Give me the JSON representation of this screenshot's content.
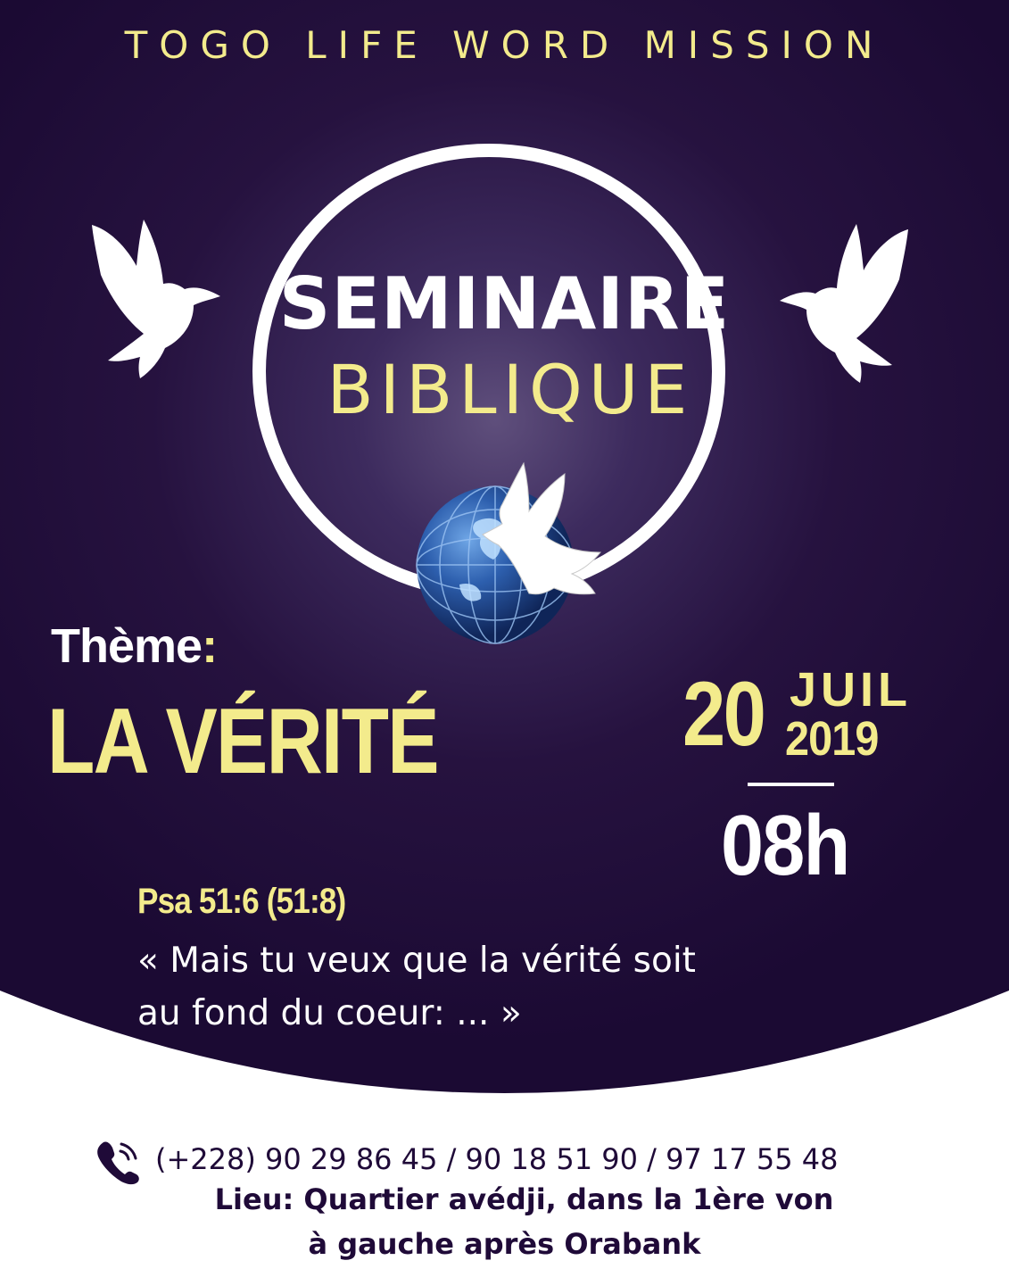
{
  "colors": {
    "background_dark": "#1b0a33",
    "background_glow": "#5a4a78",
    "accent_yellow": "#f3eb8c",
    "text_white": "#ffffff",
    "footer_text": "#1f0a38"
  },
  "header": {
    "organization": "TOGO LIFE WORD MISSION"
  },
  "title": {
    "line1": "SEMINAIRE",
    "line2": "BIBLIQUE"
  },
  "logo": {
    "icon": "globe-with-dove-icon"
  },
  "theme": {
    "label": "Thème",
    "colon": ":",
    "title": "LA VÉRITÉ"
  },
  "event": {
    "day": "20",
    "month": "JUIL",
    "year": "2019",
    "time": "08h"
  },
  "verse": {
    "reference": "Psa 51:6  (51:8)",
    "line1": "« Mais tu veux que la vérité soit",
    "line2": "au fond du coeur: ... »"
  },
  "contact": {
    "icon": "phone-icon",
    "phones": "(+228) 90 29 86 45 / 90 18 51 90 / 97 17 55 48",
    "venue_line1": "Lieu: Quartier avédji, dans la 1ère von",
    "venue_line2": "à gauche après Orabank"
  }
}
